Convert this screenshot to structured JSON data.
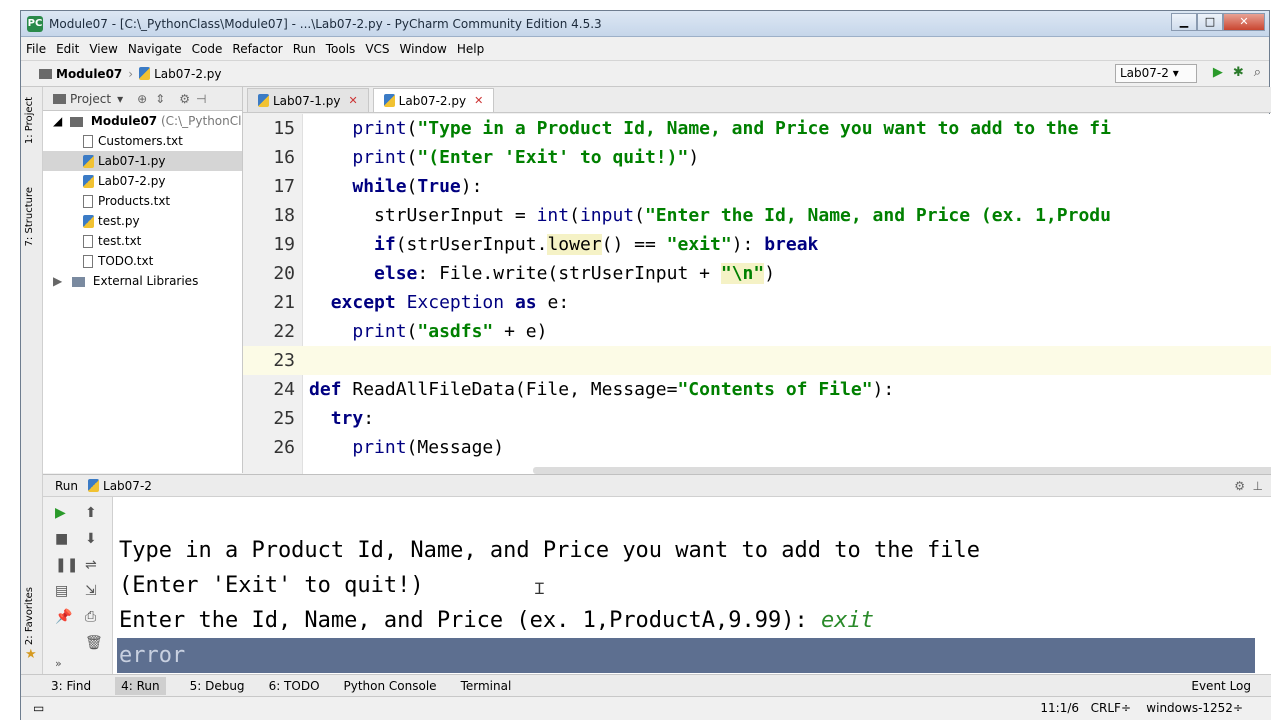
{
  "window": {
    "title": "Module07 - [C:\\_PythonClass\\Module07] - ...\\Lab07-2.py - PyCharm Community Edition 4.5.3"
  },
  "menu": [
    "File",
    "Edit",
    "View",
    "Navigate",
    "Code",
    "Refactor",
    "Run",
    "Tools",
    "VCS",
    "Window",
    "Help"
  ],
  "nav": {
    "project": "Module07",
    "file": "Lab07-2.py",
    "run_config": "Lab07-2"
  },
  "project_panel": {
    "header": "Project",
    "root": "Module07",
    "root_path": "(C:\\_PythonClass",
    "files": [
      "Customers.txt",
      "Lab07-1.py",
      "Lab07-2.py",
      "Products.txt",
      "test.py",
      "test.txt",
      "TODO.txt"
    ],
    "external": "External Libraries"
  },
  "editor_tabs": [
    "Lab07-1.py",
    "Lab07-2.py"
  ],
  "side_tabs": {
    "project": "1: Project",
    "structure": "7: Structure",
    "favorites": "2: Favorites"
  },
  "code_lines": [
    {
      "n": "15"
    },
    {
      "n": "16"
    },
    {
      "n": "17"
    },
    {
      "n": "18"
    },
    {
      "n": "19"
    },
    {
      "n": "20"
    },
    {
      "n": "21"
    },
    {
      "n": "22"
    },
    {
      "n": "23"
    },
    {
      "n": "24"
    },
    {
      "n": "25"
    },
    {
      "n": "26"
    }
  ],
  "run_panel": {
    "title": "Run",
    "config": "Lab07-2",
    "console": [
      "Type in a Product Id, Name, and Price you want to add to the file",
      "(Enter 'Exit' to quit!)",
      "Enter the Id, Name, and Price (ex. 1,ProductA,9.99): ",
      "error"
    ],
    "user_input": "exit"
  },
  "bottom_tabs": [
    "3: Find",
    "4: Run",
    "5: Debug",
    "6: TODO",
    "Python Console",
    "Terminal"
  ],
  "event_log": "Event Log",
  "status": {
    "position": "11:1/6",
    "line_sep": "CRLF÷",
    "encoding": "windows-1252÷"
  }
}
